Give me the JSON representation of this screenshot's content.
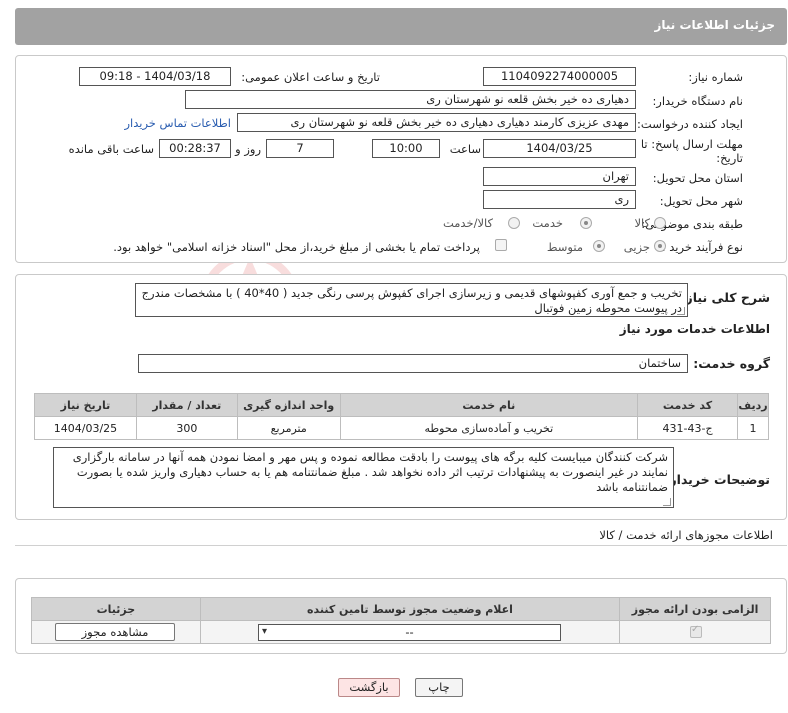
{
  "header": {
    "title": "جزئیات اطلاعات نیاز"
  },
  "need_number": {
    "label": "شماره نیاز:",
    "value": "1104092274000005"
  },
  "announce_datetime": {
    "label": "تاریخ و ساعت اعلان عمومی:",
    "value": "1404/03/18 - 09:18"
  },
  "buyer_org": {
    "label": "نام دستگاه خریدار:",
    "value": "دهیاری ده خیر بخش قلعه نو شهرستان ری"
  },
  "requester": {
    "label": "ایجاد کننده درخواست:",
    "value": "مهدی عزیزی کارمند دهیاری دهیاری ده خیر بخش قلعه نو شهرستان ری",
    "contact_link": "اطلاعات تماس خریدار"
  },
  "deadline": {
    "label_line1": "مهلت ارسال پاسخ: تا",
    "label_line2": "تاریخ:",
    "date": "1404/03/25",
    "time_label": "ساعت",
    "time": "10:00",
    "days": "7",
    "days_label": "روز و",
    "remaining": "00:28:37",
    "remaining_label": "ساعت باقی مانده"
  },
  "province": {
    "label": "استان محل تحویل:",
    "value": "تهران"
  },
  "city": {
    "label": "شهر محل تحویل:",
    "value": "ری"
  },
  "category": {
    "label": "طبقه بندی موضوعی:",
    "options": [
      "کالا",
      "خدمت",
      "کالا/خدمت"
    ],
    "selected": "خدمت"
  },
  "process_type": {
    "label": "نوع فرآیند خرید :",
    "options": [
      "جزیی",
      "متوسط"
    ],
    "selected": "جزیی",
    "note": "پرداخت تمام یا بخشی از مبلغ خرید،از محل \"اسناد خزانه اسلامی\" خواهد بود."
  },
  "description": {
    "label": "شرح کلی نیاز:",
    "value": "تخریب و جمع آوری کفپوشهای قدیمی و زیرسازی اجرای کفپوش پرسی رنگی جدید ( 40*40 ) با مشخصات مندرج در پیوست محوطه زمین فوتبال"
  },
  "services": {
    "title": "اطلاعات خدمات مورد نیاز",
    "group_label": "گروه خدمت:",
    "group_value": "ساختمان",
    "columns": [
      "ردیف",
      "کد خدمت",
      "نام خدمت",
      "واحد اندازه گیری",
      "تعداد / مقدار",
      "تاریخ نیاز"
    ],
    "rows": [
      {
        "row": "1",
        "code": "ج-43-431",
        "name": "تخریب و آماده‌سازی محوطه",
        "unit": "مترمربع",
        "qty": "300",
        "date": "1404/03/25"
      }
    ]
  },
  "buyer_notes": {
    "label": "توضیحات خریدار:",
    "value": "شرکت کنندگان میبایست کلیه برگه های پیوست را بادقت مطالعه نموده و پس مهر و امضا نمودن همه آنها در سامانه بارگزاری نمایند در غیر اینصورت به پیشنهادات ترتیب اثر داده نخواهد شد . مبلغ ضمانتنامه هم یا به حساب دهیاری واریز شده یا بصورت ضمانتنامه باشد"
  },
  "permits": {
    "title": "اطلاعات مجوزهای ارائه خدمت / کالا",
    "columns": [
      "الزامی بودن ارائه مجوز",
      "اعلام وضعیت مجوز توسط تامین کننده",
      "جزئیات"
    ],
    "select_value": "--",
    "view_button": "مشاهده مجوز"
  },
  "buttons": {
    "print": "چاپ",
    "back": "بازگشت"
  },
  "watermark": "AriaTender.neT"
}
